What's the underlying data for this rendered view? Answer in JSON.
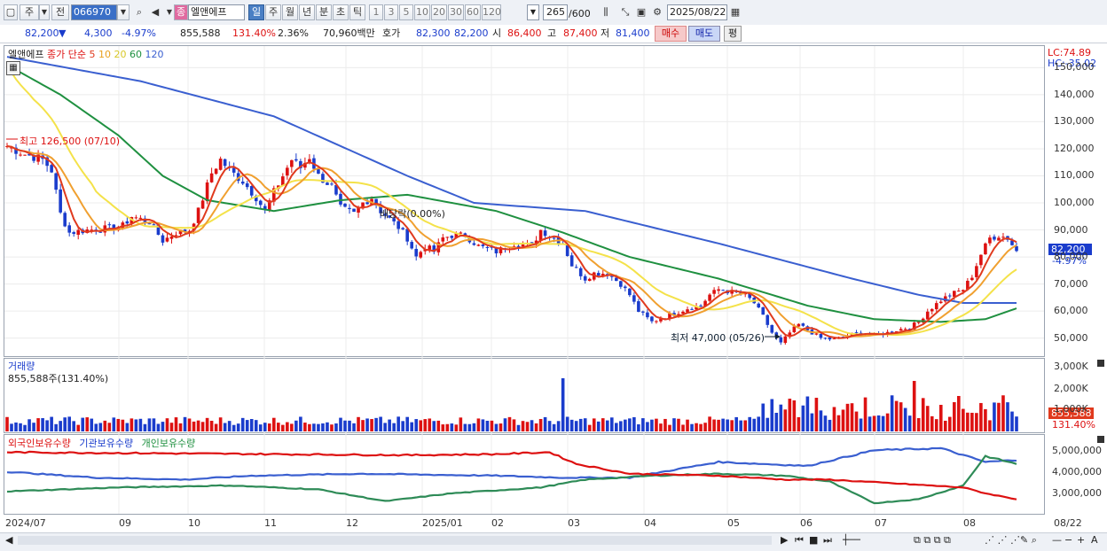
{
  "toolbar": {
    "market": "주",
    "type_label": "전",
    "code": "066970",
    "name_tag": "종",
    "name": "엘앤에프",
    "periods": [
      "일",
      "주",
      "월",
      "년",
      "분",
      "초",
      "틱"
    ],
    "active_period": "일",
    "minute_options": [
      "1",
      "3",
      "5",
      "10",
      "20",
      "30",
      "60",
      "120"
    ],
    "count": "265",
    "max_count": "/600",
    "date": "2025/08/22"
  },
  "info": {
    "price": "82,200",
    "arrow": "▼",
    "change": "4,300",
    "change_pct": "-4.97%",
    "volume": "855,588",
    "vol_ratio": "131.40%",
    "turnover_pct": "2.36%",
    "amount": "70,960백만",
    "bid_label": "호가",
    "bid1": "82,300",
    "bid2": "82,200",
    "open_label": "시",
    "open": "86,400",
    "high_label": "고",
    "high": "87,400",
    "low_label": "저",
    "low": "81,400",
    "buy": "매수",
    "sell": "매도",
    "avg": "평"
  },
  "colors": {
    "up": "#d11",
    "down": "#1a3ccc",
    "ma5": "#e03a1e",
    "ma10": "#f0a030",
    "ma20": "#f4e24a",
    "ma60": "#1f9040",
    "ma120": "#3a5fd0"
  },
  "price_pane": {
    "title": "엘앤에프",
    "ma_label": "종가 단순",
    "ma_list": [
      "5",
      "10",
      "20",
      "60",
      "120"
    ],
    "lc": "LC:74.89",
    "hc": "HC:-35.02",
    "y_ticks": [
      "150,000",
      "140,000",
      "130,000",
      "120,000",
      "110,000",
      "100,000",
      "90,000",
      "80,000",
      "70,000",
      "60,000",
      "50,000"
    ],
    "high_note": "최고 126,500 (07/10)",
    "low_note": "최저 47,000 (05/26)",
    "ex_note": "배당락(0.00%)",
    "last_price": "82,200",
    "last_pct": "-4.97%"
  },
  "volume_pane": {
    "title": "거래량",
    "value": "855,588주(131.40%)",
    "y_ticks": [
      "3,000K",
      "2,000K",
      "1,000K"
    ],
    "last": "855,588",
    "last_pct": "131.40%"
  },
  "holdings_pane": {
    "legend": [
      "외국인보유수량",
      "기관보유수량",
      "개인보유수량"
    ],
    "y_ticks": [
      "5,000,000",
      "4,000,000",
      "3,000,000"
    ]
  },
  "x_ticks": [
    "2024/07",
    "09",
    "10",
    "11",
    "12",
    "2025/01",
    "02",
    "03",
    "04",
    "05",
    "06",
    "07",
    "08",
    "08/22"
  ],
  "chart_data": {
    "type": "line",
    "x_range": [
      "2024/07",
      "2025/08/22"
    ],
    "price_ylim": [
      44000,
      157000
    ],
    "close_path": [
      [
        0,
        121000
      ],
      [
        4,
        118000
      ],
      [
        8,
        116000
      ],
      [
        10,
        112000
      ],
      [
        12,
        96000
      ],
      [
        14,
        89000
      ],
      [
        18,
        90000
      ],
      [
        22,
        90500
      ],
      [
        26,
        91500
      ],
      [
        28,
        95000
      ],
      [
        32,
        93000
      ],
      [
        35,
        86000
      ],
      [
        38,
        89000
      ],
      [
        41,
        90000
      ],
      [
        43,
        97000
      ],
      [
        46,
        111000
      ],
      [
        48,
        116000
      ],
      [
        50,
        112000
      ],
      [
        53,
        108000
      ],
      [
        56,
        102000
      ],
      [
        58,
        97000
      ],
      [
        60,
        104000
      ],
      [
        62,
        110000
      ],
      [
        64,
        116000
      ],
      [
        66,
        113000
      ],
      [
        68,
        117000
      ],
      [
        70,
        110000
      ],
      [
        73,
        106000
      ],
      [
        75,
        98000
      ],
      [
        78,
        96000
      ],
      [
        80,
        100000
      ],
      [
        82,
        102000
      ],
      [
        84,
        97000
      ],
      [
        86,
        94000
      ],
      [
        88,
        91000
      ],
      [
        90,
        87000
      ],
      [
        92,
        80000
      ],
      [
        94,
        84000
      ],
      [
        96,
        82000
      ],
      [
        98,
        87000
      ],
      [
        100,
        88000
      ],
      [
        103,
        88000
      ],
      [
        106,
        84000
      ],
      [
        110,
        82000
      ],
      [
        114,
        85000
      ],
      [
        118,
        84000
      ],
      [
        120,
        90000
      ],
      [
        122,
        88000
      ],
      [
        125,
        85000
      ],
      [
        127,
        77000
      ],
      [
        130,
        72000
      ],
      [
        132,
        74000
      ],
      [
        135,
        74000
      ],
      [
        138,
        70000
      ],
      [
        140,
        66000
      ],
      [
        142,
        60000
      ],
      [
        145,
        56000
      ],
      [
        148,
        58000
      ],
      [
        150,
        59000
      ],
      [
        153,
        61000
      ],
      [
        156,
        62000
      ],
      [
        158,
        66000
      ],
      [
        160,
        68000
      ],
      [
        163,
        67000
      ],
      [
        166,
        66000
      ],
      [
        168,
        63000
      ],
      [
        170,
        58000
      ],
      [
        172,
        52000
      ],
      [
        174,
        48000
      ],
      [
        176,
        52000
      ],
      [
        178,
        55000
      ],
      [
        180,
        53000
      ],
      [
        183,
        50000
      ],
      [
        186,
        49500
      ],
      [
        189,
        51000
      ],
      [
        192,
        52000
      ],
      [
        195,
        51000
      ],
      [
        198,
        52000
      ],
      [
        200,
        53000
      ],
      [
        203,
        54000
      ],
      [
        205,
        56000
      ],
      [
        207,
        60000
      ],
      [
        210,
        64000
      ],
      [
        212,
        66000
      ],
      [
        215,
        68000
      ],
      [
        217,
        73000
      ],
      [
        219,
        81000
      ],
      [
        221,
        87000
      ],
      [
        223,
        88000
      ],
      [
        225,
        87000
      ],
      [
        227,
        82200
      ]
    ],
    "series": [
      {
        "name": "5",
        "values": "close moving average 5"
      },
      {
        "name": "10",
        "values": "close moving average 10"
      },
      {
        "name": "20",
        "values": "close moving average 20"
      },
      {
        "name": "60",
        "values": "close moving average 60"
      },
      {
        "name": "120",
        "values": "close moving average 120"
      }
    ],
    "ma120_path": [
      [
        0,
        154000
      ],
      [
        30,
        145000
      ],
      [
        60,
        132000
      ],
      [
        90,
        110000
      ],
      [
        105,
        100000
      ],
      [
        130,
        97000
      ],
      [
        160,
        85000
      ],
      [
        190,
        72000
      ],
      [
        205,
        66000
      ],
      [
        215,
        63000
      ],
      [
        227,
        63000
      ]
    ],
    "ma60_path": [
      [
        0,
        151000
      ],
      [
        12,
        140000
      ],
      [
        25,
        125000
      ],
      [
        35,
        110000
      ],
      [
        45,
        101000
      ],
      [
        60,
        97000
      ],
      [
        75,
        101000
      ],
      [
        90,
        103000
      ],
      [
        110,
        97000
      ],
      [
        125,
        89000
      ],
      [
        140,
        80000
      ],
      [
        160,
        72000
      ],
      [
        180,
        62000
      ],
      [
        195,
        57000
      ],
      [
        210,
        56000
      ],
      [
        220,
        57000
      ],
      [
        227,
        61000
      ]
    ],
    "holdings_ylim": [
      1800000,
      5600000
    ],
    "foreign_path": [
      [
        0,
        4900000
      ],
      [
        30,
        4850000
      ],
      [
        60,
        4800000
      ],
      [
        90,
        4750000
      ],
      [
        110,
        4800000
      ],
      [
        122,
        4900000
      ],
      [
        128,
        4300000
      ],
      [
        140,
        3800000
      ],
      [
        160,
        3700000
      ],
      [
        175,
        3500000
      ],
      [
        185,
        3500000
      ],
      [
        200,
        3300000
      ],
      [
        215,
        3100000
      ],
      [
        220,
        2800000
      ],
      [
        227,
        2500000
      ]
    ],
    "inst_path": [
      [
        0,
        3900000
      ],
      [
        20,
        3600000
      ],
      [
        40,
        3500000
      ],
      [
        55,
        3700000
      ],
      [
        80,
        3800000
      ],
      [
        110,
        3700000
      ],
      [
        125,
        3600000
      ],
      [
        140,
        3600000
      ],
      [
        160,
        4400000
      ],
      [
        180,
        4200000
      ],
      [
        195,
        5000000
      ],
      [
        210,
        5100000
      ],
      [
        220,
        4400000
      ],
      [
        227,
        4500000
      ]
    ],
    "indiv_path": [
      [
        0,
        2900000
      ],
      [
        25,
        3100000
      ],
      [
        50,
        3200000
      ],
      [
        70,
        3000000
      ],
      [
        85,
        2400000
      ],
      [
        100,
        2800000
      ],
      [
        120,
        3100000
      ],
      [
        130,
        3500000
      ],
      [
        145,
        3700000
      ],
      [
        160,
        3800000
      ],
      [
        175,
        3700000
      ],
      [
        185,
        3400000
      ],
      [
        195,
        2300000
      ],
      [
        205,
        2500000
      ],
      [
        215,
        3200000
      ],
      [
        220,
        4700000
      ],
      [
        227,
        4300000
      ]
    ]
  }
}
